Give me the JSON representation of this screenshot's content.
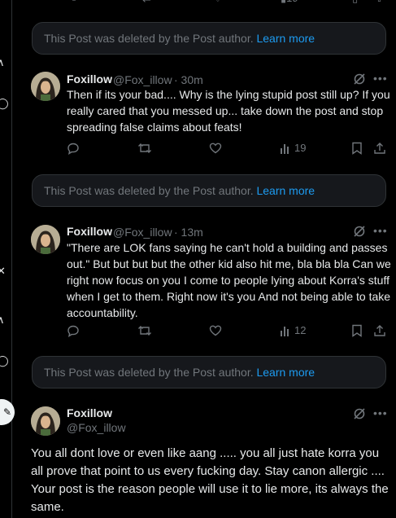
{
  "deleted_notice": {
    "text": "This Post was deleted by the Post author.",
    "link": "Learn more"
  },
  "replies": [
    {
      "name": "Foxillow",
      "handle": "@Fox_illow",
      "time": "· 30m",
      "text": "Then if its your bad.... Why is the lying stupid post still up? If you really cared that you messed up... take down the post and stop spreading false claims about feats!",
      "views": "19"
    },
    {
      "name": "Foxillow",
      "handle": "@Fox_illow",
      "time": "· 13m",
      "text": "\"There are LOK fans saying he can't hold a building and passes out.\" But but but but the other kid also hit me, bla bla bla Can we right now focus on you I come to people lying about Korra's stuff when I get to them. Right now it's you And not being able to take accountability.",
      "views": "12"
    }
  ],
  "focused_post": {
    "name": "Foxillow",
    "handle": "@Fox_illow",
    "text": "You all dont love or even like aang ..... you all just hate korra you all prove that point to us every fucking day. Stay canon allergic .... Your post is the reason people will use it to lie more, its always the same."
  },
  "top_partial": {
    "views": "19"
  },
  "colors": {
    "accent": "#1d9bf0",
    "muted": "#71767b",
    "text": "#e7e9ea",
    "background": "#000000"
  },
  "icons": [
    "reply-icon",
    "retweet-icon",
    "like-icon",
    "views-icon",
    "bookmark-icon",
    "share-icon",
    "grok-icon",
    "more-icon"
  ]
}
